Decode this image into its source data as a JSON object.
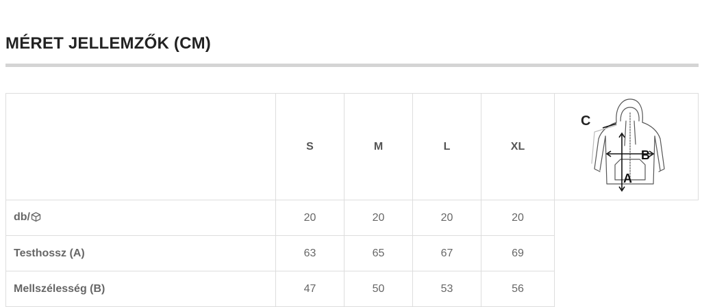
{
  "title": "MÉRET JELLEMZŐK (CM)",
  "table": {
    "columns": [
      "S",
      "M",
      "L",
      "XL"
    ],
    "rows": [
      {
        "label": "db/",
        "label_icon": "box-icon",
        "values": [
          "20",
          "20",
          "20",
          "20"
        ]
      },
      {
        "label": "Testhossz (A)",
        "values": [
          "63",
          "65",
          "67",
          "69"
        ]
      },
      {
        "label": "Mellszélesség (B)",
        "values": [
          "47",
          "50",
          "53",
          "56"
        ]
      }
    ]
  },
  "diagram": {
    "labels": {
      "a": "A",
      "b": "B",
      "c": "C"
    },
    "icon": "hoodie-sketch"
  }
}
